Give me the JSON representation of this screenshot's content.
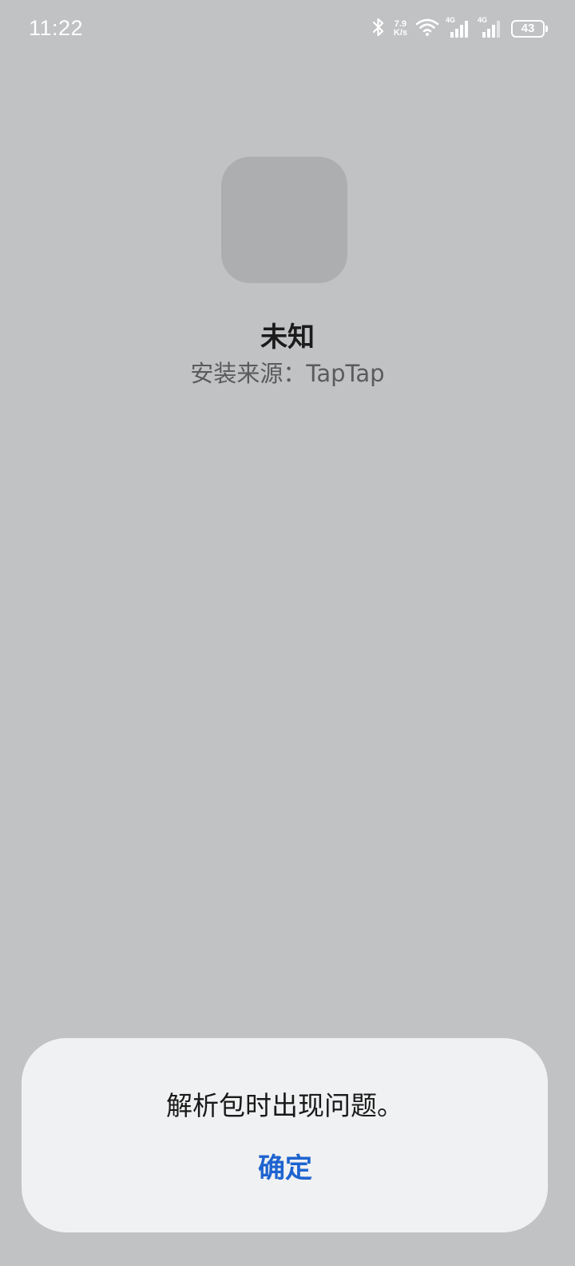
{
  "status_bar": {
    "time": "11:22",
    "net_speed_value": "7.9",
    "net_speed_unit": "K/s",
    "signal1_label": "4G",
    "signal2_label": "4G",
    "battery": "43",
    "icons": [
      "bluetooth-icon",
      "wifi-icon",
      "signal-icon",
      "signal-icon",
      "battery-icon"
    ],
    "text_color": "#ffffff"
  },
  "app": {
    "name": "未知",
    "source": "安装来源：TapTap"
  },
  "dialog": {
    "message": "解析包时出现问题。",
    "confirm_label": "确定",
    "accent_color": "#1e64d0"
  },
  "background_color": "#c1c2c4"
}
